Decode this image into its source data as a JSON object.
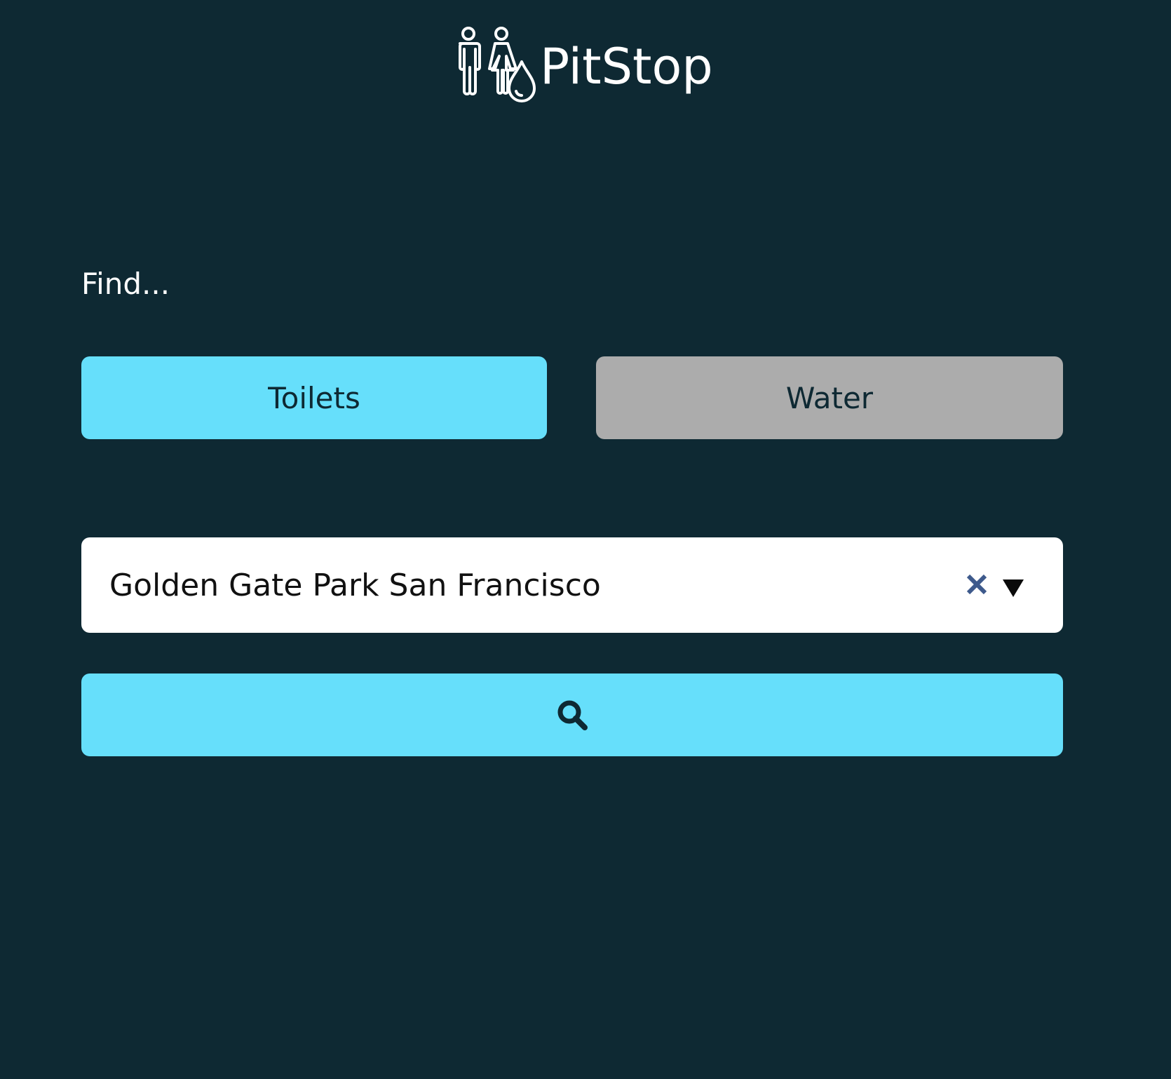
{
  "header": {
    "brand": "PitStop",
    "logo_icon": "restroom-water-drop-icon"
  },
  "find": {
    "label": "Find..."
  },
  "toggles": {
    "toilets_label": "Toilets",
    "water_label": "Water",
    "selected": "Toilets",
    "active_color": "#66dffb",
    "inactive_color": "#acacac"
  },
  "location": {
    "value": "Golden Gate Park San Francisco",
    "clear_icon": "close-icon",
    "dropdown_icon": "triangle-down-icon"
  },
  "search": {
    "icon": "search-icon"
  },
  "colors": {
    "background": "#0e2933",
    "accent": "#66dffb",
    "clear_icon": "#3e5a8c"
  }
}
